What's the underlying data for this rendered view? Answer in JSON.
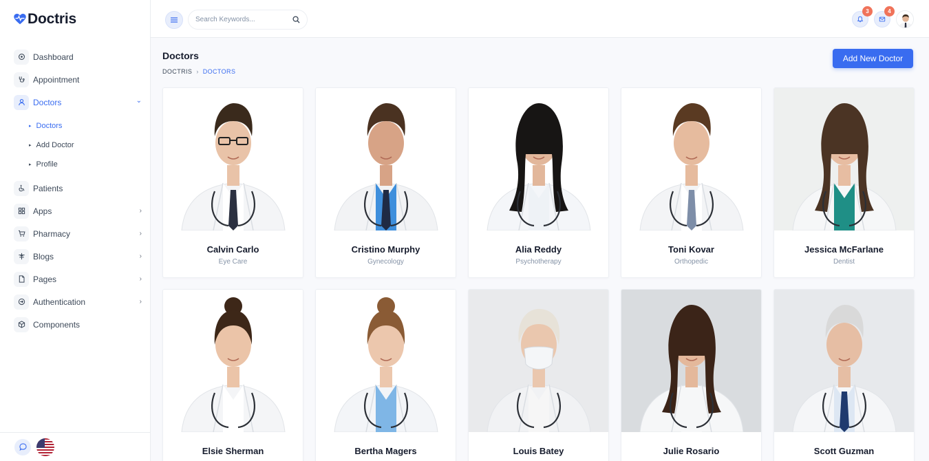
{
  "brand": {
    "name": "Doctris"
  },
  "sidebar": {
    "items": [
      {
        "label": "Dashboard",
        "icon": "home-icon",
        "active": false,
        "chevron": false
      },
      {
        "label": "Appointment",
        "icon": "stethoscope-icon",
        "active": false,
        "chevron": false
      },
      {
        "label": "Doctors",
        "icon": "user-icon",
        "active": true,
        "chevron": true,
        "open": true
      },
      {
        "label": "Patients",
        "icon": "wheelchair-icon",
        "active": false,
        "chevron": false
      },
      {
        "label": "Apps",
        "icon": "grid-icon",
        "active": false,
        "chevron": true
      },
      {
        "label": "Pharmacy",
        "icon": "cart-icon",
        "active": false,
        "chevron": true
      },
      {
        "label": "Blogs",
        "icon": "sidebar-icon",
        "active": false,
        "chevron": true
      },
      {
        "label": "Pages",
        "icon": "file-icon",
        "active": false,
        "chevron": true
      },
      {
        "label": "Authentication",
        "icon": "login-icon",
        "active": false,
        "chevron": true
      },
      {
        "label": "Components",
        "icon": "cube-icon",
        "active": false,
        "chevron": false
      }
    ],
    "doctors_submenu": [
      {
        "label": "Doctors",
        "active": true
      },
      {
        "label": "Add Doctor",
        "active": false
      },
      {
        "label": "Profile",
        "active": false
      }
    ]
  },
  "topbar": {
    "search_placeholder": "Search Keywords...",
    "notifications_count": "3",
    "messages_count": "4"
  },
  "page": {
    "title": "Doctors",
    "breadcrumb": [
      "DOCTRIS",
      "DOCTORS"
    ],
    "add_button": "Add New Doctor"
  },
  "doctors": [
    {
      "name": "Calvin Carlo",
      "specialty": "Eye Care",
      "bg": "#ffffff",
      "skin": "#e9c3a8",
      "hair": "#3a2a1c",
      "coat": "#f4f5f7",
      "shirt": "#ffffff",
      "tie": "#2b3040",
      "glasses": true,
      "mask": false
    },
    {
      "name": "Cristino Murphy",
      "specialty": "Gynecology",
      "bg": "#ffffff",
      "skin": "#d7a386",
      "hair": "#4a3221",
      "coat": "#f2f3f5",
      "shirt": "#3f8fdc",
      "tie": "#1f2a44",
      "glasses": false,
      "mask": false
    },
    {
      "name": "Alia Reddy",
      "specialty": "Psychotherapy",
      "bg": "#ffffff",
      "skin": "#e2b79b",
      "hair": "#171514",
      "coat": "#f4f6f9",
      "shirt": "#eef2f6",
      "tie": "",
      "glasses": false,
      "mask": false
    },
    {
      "name": "Toni Kovar",
      "specialty": "Orthopedic",
      "bg": "#ffffff",
      "skin": "#e6bb9e",
      "hair": "#5a3a22",
      "coat": "#f3f4f6",
      "shirt": "#ffffff",
      "tie": "#7e8ea8",
      "glasses": false,
      "mask": false
    },
    {
      "name": "Jessica McFarlane",
      "specialty": "Dentist",
      "bg": "#eef0ef",
      "skin": "#e7bda2",
      "hair": "#4b3424",
      "coat": "#f6f7f8",
      "shirt": "#1f8f86",
      "tie": "",
      "glasses": false,
      "mask": false
    },
    {
      "name": "Elsie Sherman",
      "specialty": "",
      "bg": "#ffffff",
      "skin": "#ebc4a8",
      "hair": "#3d2718",
      "coat": "#f4f5f7",
      "shirt": "#ffffff",
      "tie": "",
      "glasses": false,
      "mask": false
    },
    {
      "name": "Bertha Magers",
      "specialty": "",
      "bg": "#ffffff",
      "skin": "#ecc7ad",
      "hair": "#8a5b35",
      "coat": "#f3f5f8",
      "shirt": "#7fb6e6",
      "tie": "",
      "glasses": false,
      "mask": false
    },
    {
      "name": "Louis Batey",
      "specialty": "",
      "bg": "#e9eaec",
      "skin": "#eac7ae",
      "hair": "#e7e2d8",
      "coat": "#f1f2f4",
      "shirt": "#f6f6f6",
      "tie": "",
      "glasses": false,
      "mask": true
    },
    {
      "name": "Julie Rosario",
      "specialty": "",
      "bg": "#d9dcdf",
      "skin": "#e4b89b",
      "hair": "#3b2418",
      "coat": "#f6f7f8",
      "shirt": "#f6f7f8",
      "tie": "",
      "glasses": false,
      "mask": false
    },
    {
      "name": "Scott Guzman",
      "specialty": "",
      "bg": "#e7e9ec",
      "skin": "#e6bea4",
      "hair": "#d9d9d9",
      "coat": "#f5f6f8",
      "shirt": "#dde7f3",
      "tie": "#1f3a6e",
      "glasses": false,
      "mask": false
    }
  ]
}
